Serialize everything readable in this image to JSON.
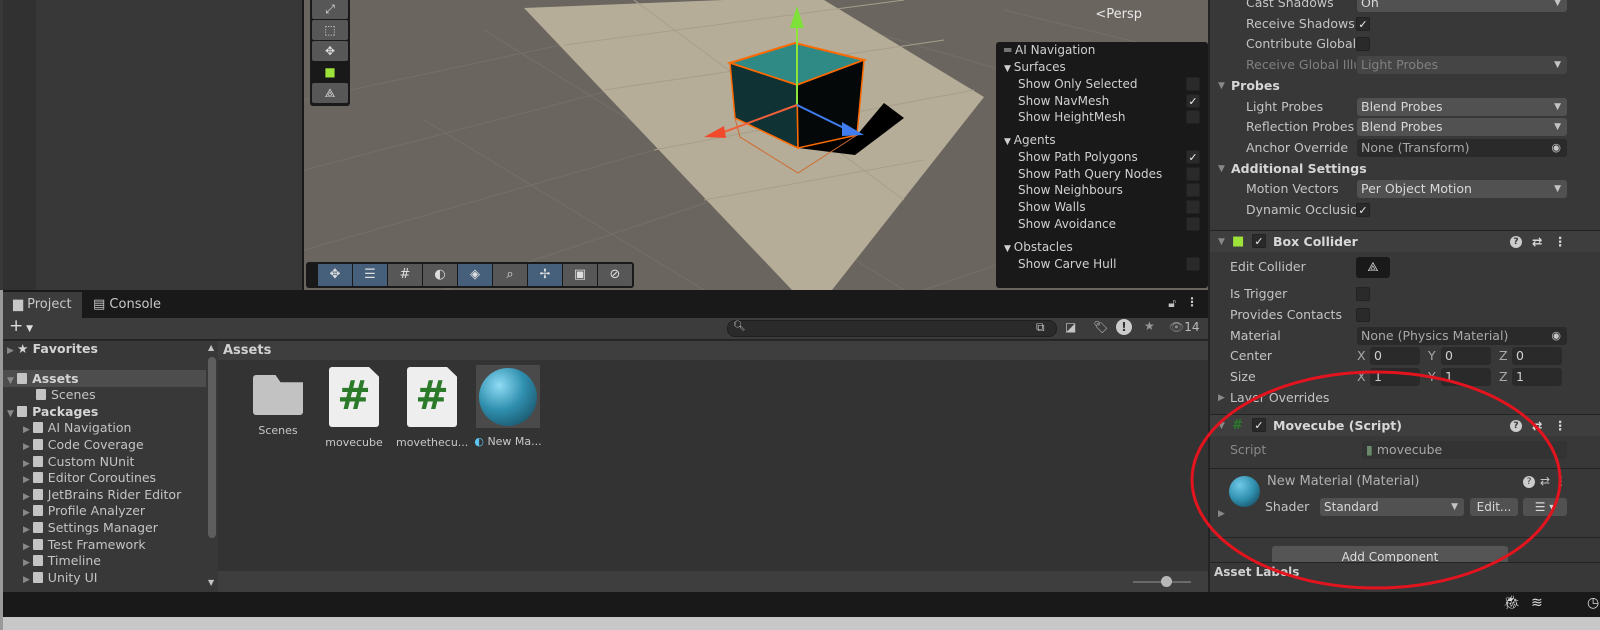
{
  "scene": {
    "persp_label": "Persp",
    "tools_vertical": [
      "rect-scale-tool",
      "rect-tool",
      "transform-tool",
      "box-collider-tool",
      "edit-collider-tool"
    ],
    "toolbar_bottom": [
      {
        "icon": "move-icon",
        "active": true
      },
      {
        "icon": "snap-settings-icon",
        "active": true
      },
      {
        "icon": "grid-icon",
        "active": false
      },
      {
        "icon": "shading-icon",
        "active": false
      },
      {
        "icon": "navmesh-icon",
        "active": true
      },
      {
        "icon": "search-icon",
        "active": false
      },
      {
        "icon": "pivot-icon",
        "active": true
      },
      {
        "icon": "camera-icon",
        "active": false
      },
      {
        "icon": "compass-icon",
        "active": false
      }
    ]
  },
  "ai_navigation": {
    "title": "AI Navigation",
    "sections": [
      {
        "label": "Surfaces",
        "items": [
          {
            "label": "Show Only Selected",
            "checked": false
          },
          {
            "label": "Show NavMesh",
            "checked": true
          },
          {
            "label": "Show HeightMesh",
            "checked": false
          }
        ]
      },
      {
        "label": "Agents",
        "items": [
          {
            "label": "Show Path Polygons",
            "checked": true
          },
          {
            "label": "Show Path Query Nodes",
            "checked": false
          },
          {
            "label": "Show Neighbours",
            "checked": false
          },
          {
            "label": "Show Walls",
            "checked": false
          },
          {
            "label": "Show Avoidance",
            "checked": false
          }
        ]
      },
      {
        "label": "Obstacles",
        "items": [
          {
            "label": "Show Carve Hull",
            "checked": false
          }
        ]
      }
    ]
  },
  "project": {
    "tabs": [
      {
        "label": "Project",
        "icon": "folder-icon"
      },
      {
        "label": "Console",
        "icon": "console-icon"
      }
    ],
    "add_label": "+",
    "search_placeholder": "",
    "hidden_count": "14",
    "tree": [
      {
        "label": "Favorites",
        "level": 0,
        "bold": true,
        "icon": "star-icon",
        "expanded": false
      },
      {
        "label": "Assets",
        "level": 0,
        "bold": true,
        "icon": "folder-open-icon",
        "expanded": true,
        "selected": true
      },
      {
        "label": "Scenes",
        "level": 1,
        "icon": "folder-icon"
      },
      {
        "label": "Packages",
        "level": 0,
        "bold": true,
        "icon": "folder-open-icon",
        "expanded": true
      },
      {
        "label": "AI Navigation",
        "level": 1,
        "icon": "folder-icon",
        "expanded": false
      },
      {
        "label": "Code Coverage",
        "level": 1,
        "icon": "folder-icon",
        "expanded": false
      },
      {
        "label": "Custom NUnit",
        "level": 1,
        "icon": "folder-icon",
        "expanded": false
      },
      {
        "label": "Editor Coroutines",
        "level": 1,
        "icon": "folder-icon",
        "expanded": false
      },
      {
        "label": "JetBrains Rider Editor",
        "level": 1,
        "icon": "folder-icon",
        "expanded": false
      },
      {
        "label": "Profile Analyzer",
        "level": 1,
        "icon": "folder-icon",
        "expanded": false
      },
      {
        "label": "Settings Manager",
        "level": 1,
        "icon": "folder-icon",
        "expanded": false
      },
      {
        "label": "Test Framework",
        "level": 1,
        "icon": "folder-icon",
        "expanded": false
      },
      {
        "label": "Timeline",
        "level": 1,
        "icon": "folder-icon",
        "expanded": false
      },
      {
        "label": "Unity UI",
        "level": 1,
        "icon": "folder-icon",
        "expanded": false
      }
    ],
    "breadcrumb": "Assets",
    "assets": [
      {
        "label": "Scenes",
        "type": "folder"
      },
      {
        "label": "movecube",
        "type": "script"
      },
      {
        "label": "movethecu...",
        "type": "script"
      },
      {
        "label": "New Ma...",
        "type": "material"
      }
    ]
  },
  "inspector": {
    "rows": [
      {
        "label": "Cast Shadows",
        "type": "dropdown",
        "value": "On"
      },
      {
        "label": "Receive Shadows",
        "type": "check",
        "checked": true
      },
      {
        "label": "Contribute Global",
        "type": "check",
        "checked": false
      },
      {
        "label": "Receive Global Illu",
        "type": "dropdown",
        "value": "Light Probes",
        "disabled": true
      },
      {
        "label": "Probes",
        "type": "header"
      },
      {
        "label": "Light Probes",
        "type": "dropdown",
        "value": "Blend Probes"
      },
      {
        "label": "Reflection Probes",
        "type": "dropdown",
        "value": "Blend Probes"
      },
      {
        "label": "Anchor Override",
        "type": "object",
        "value": "None (Transform)"
      },
      {
        "label": "Additional Settings",
        "type": "header"
      },
      {
        "label": "Motion Vectors",
        "type": "dropdown",
        "value": "Per Object Motion"
      },
      {
        "label": "Dynamic Occlusion",
        "type": "check",
        "checked": true
      }
    ],
    "box_collider": {
      "title": "Box Collider",
      "enabled": true,
      "edit_collider_label": "Edit Collider",
      "is_trigger_label": "Is Trigger",
      "is_trigger": false,
      "provides_contacts_label": "Provides Contacts",
      "provides_contacts": false,
      "material_label": "Material",
      "material_value": "None (Physics Material)",
      "center_label": "Center",
      "center": {
        "x": "0",
        "y": "0",
        "z": "0"
      },
      "size_label": "Size",
      "size": {
        "x": "1",
        "y": "1",
        "z": "1"
      },
      "layer_overrides_label": "Layer Overrides"
    },
    "script_component": {
      "title": "Movecube (Script)",
      "enabled": true,
      "script_label": "Script",
      "script_value": "movecube"
    },
    "material": {
      "title": "New Material (Material)",
      "shader_label": "Shader",
      "shader_value": "Standard",
      "edit_label": "Edit..."
    },
    "add_component_label": "Add Component",
    "asset_labels": "Asset Labels"
  },
  "colors": {
    "annotation": "#e3141e",
    "selection_outline": "#ff6a00",
    "material": "#2f8fae"
  }
}
